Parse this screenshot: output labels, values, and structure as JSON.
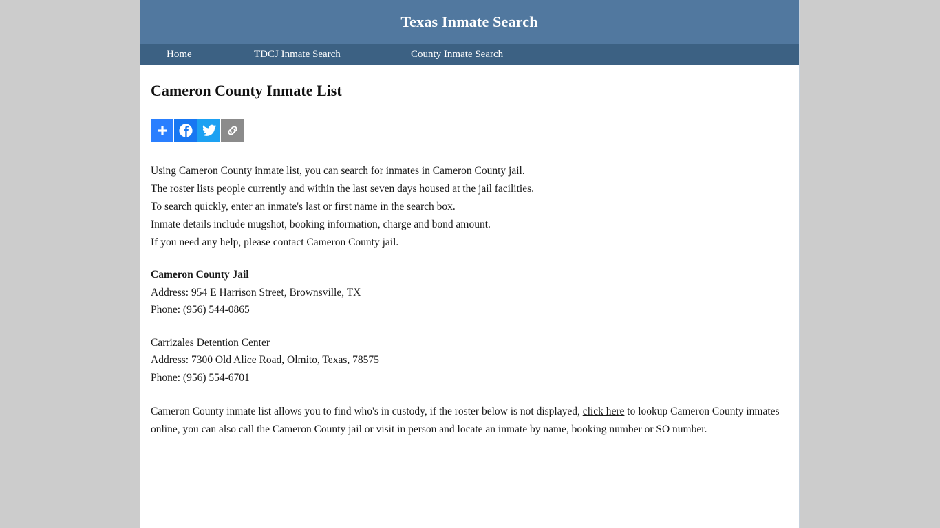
{
  "site": {
    "title": "Texas Inmate Search",
    "nav": [
      {
        "label": "Home",
        "name": "nav-item-home"
      },
      {
        "label": "TDCJ Inmate Search",
        "name": "nav-item-tdcj-inmate-search"
      },
      {
        "label": "County Inmate Search",
        "name": "nav-item-county-inmate-search"
      }
    ]
  },
  "page": {
    "title": "Cameron County Inmate List"
  },
  "share": {
    "buttons": [
      {
        "label": "Share",
        "icon": "plus-icon",
        "color": "#2a7fff"
      },
      {
        "label": "Facebook",
        "icon": "facebook-icon",
        "color": "#1877f2"
      },
      {
        "label": "Twitter",
        "icon": "twitter-icon",
        "color": "#1da1f2"
      },
      {
        "label": "Copy Link",
        "icon": "link-icon",
        "color": "#8b8b8b"
      }
    ]
  },
  "intro": {
    "line1": "Using Cameron County inmate list, you can search for inmates in Cameron County jail.",
    "line2": "The roster lists people currently and within the last seven days housed at the jail facilities.",
    "line3": "To search quickly, enter an inmate's last or first name in the search box.",
    "line4": "Inmate details include mugshot, booking information, charge and bond amount.",
    "line5": "If you need any help, please contact Cameron County jail."
  },
  "facilities": [
    {
      "name": "Cameron County Jail",
      "address": "Address: 954 E Harrison Street, Brownsville, TX",
      "phone": "Phone: (956) 544-0865"
    },
    {
      "name": "Carrizales Detention Center",
      "address": "Address: 7300 Old Alice Road, Olmito, Texas, 78575",
      "phone": "Phone: (956) 554-6701"
    }
  ],
  "closing": {
    "part1": "Cameron County inmate list allows you to find who's in custody, if the roster below is not displayed, ",
    "link_text": "click here",
    "part2": " to lookup Cameron County inmates online, you can also call the Cameron County jail or visit in person and locate an inmate by name, booking number or SO number."
  },
  "colors": {
    "header_bg": "#51789f",
    "nav_bg": "#3c6183",
    "page_bg": "#cccccc",
    "content_bg": "#ffffff",
    "text": "#1a1a1a"
  }
}
